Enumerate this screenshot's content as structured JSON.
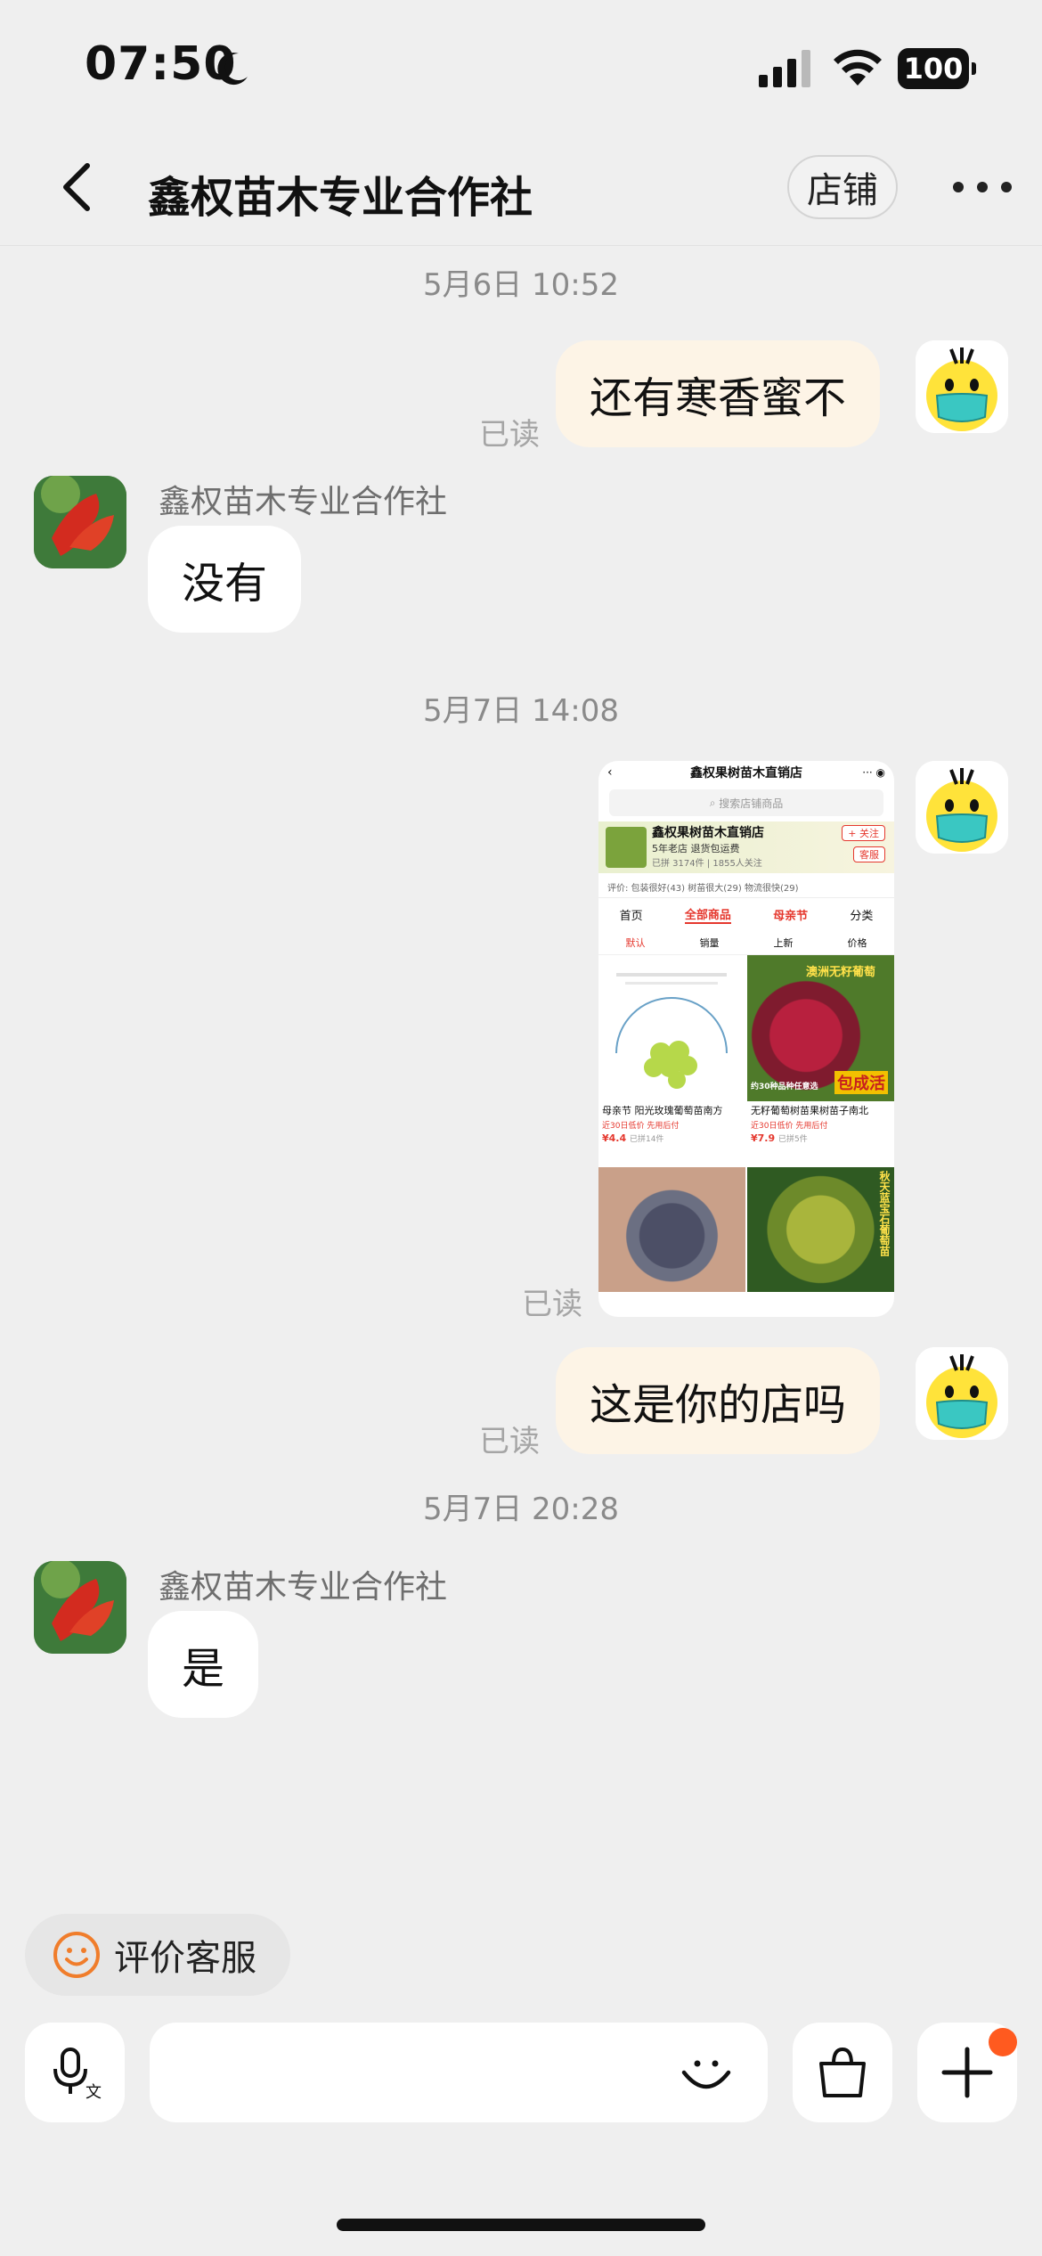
{
  "status_bar": {
    "time": "07:50",
    "battery": "100"
  },
  "header": {
    "title": "鑫权苗木专业合作社",
    "shop_label": "店铺"
  },
  "messages": {
    "ts1": "5月6日 10:52",
    "m1_text": "还有寒香蜜不",
    "m1_read": "已读",
    "m2_sender": "鑫权苗木专业合作社",
    "m2_text": "没有",
    "ts2": "5月7日 14:08",
    "m3_read": "已读",
    "m4_text": "这是你的店吗",
    "m4_read": "已读",
    "ts3": "5月7日 20:28",
    "m5_sender": "鑫权苗木专业合作社",
    "m5_text": "是"
  },
  "shared_screenshot": {
    "title": "鑫权果树苗木直销店",
    "search_placeholder": "搜索店铺商品",
    "store_name": "鑫权果树苗木直销店",
    "store_tag": "5年老店  退货包运费",
    "store_stats": "已拼 3174件 | 1855人关注",
    "follow": "+ 关注",
    "service": "客服",
    "evaluation": "评价:  包装很好(43)  树苗很大(29)  物流很快(29)",
    "tabs": [
      "首页",
      "全部商品",
      "母亲节",
      "分类"
    ],
    "sorts": [
      "默认",
      "销量",
      "上新",
      "价格"
    ],
    "card1_title": "母亲节 阳光玫瑰葡萄苗南方",
    "card1_sub": "近30日低价  先用后付",
    "card1_price": "¥4.4",
    "card1_sold": "已拼14件",
    "card2_title": "无籽葡萄树苗果树苗子南北",
    "card2_sub": "近30日低价  先用后付",
    "card2_price": "¥7.9",
    "card2_sold": "已拼5件",
    "card2_overlay_top": "澳洲无籽葡萄",
    "card2_overlay_bottom": "包成活",
    "card2_overlay_small": "约30种品种任意选",
    "card4_overlay": "秋天蓝宝石葡萄苗"
  },
  "bottom": {
    "rate_label": "评价客服",
    "input_placeholder": ""
  },
  "colors": {
    "accent": "#e5382e",
    "self_bubble": "#fdf4e6",
    "notify": "#ff5a1f",
    "rate_icon": "#f07d2b"
  }
}
